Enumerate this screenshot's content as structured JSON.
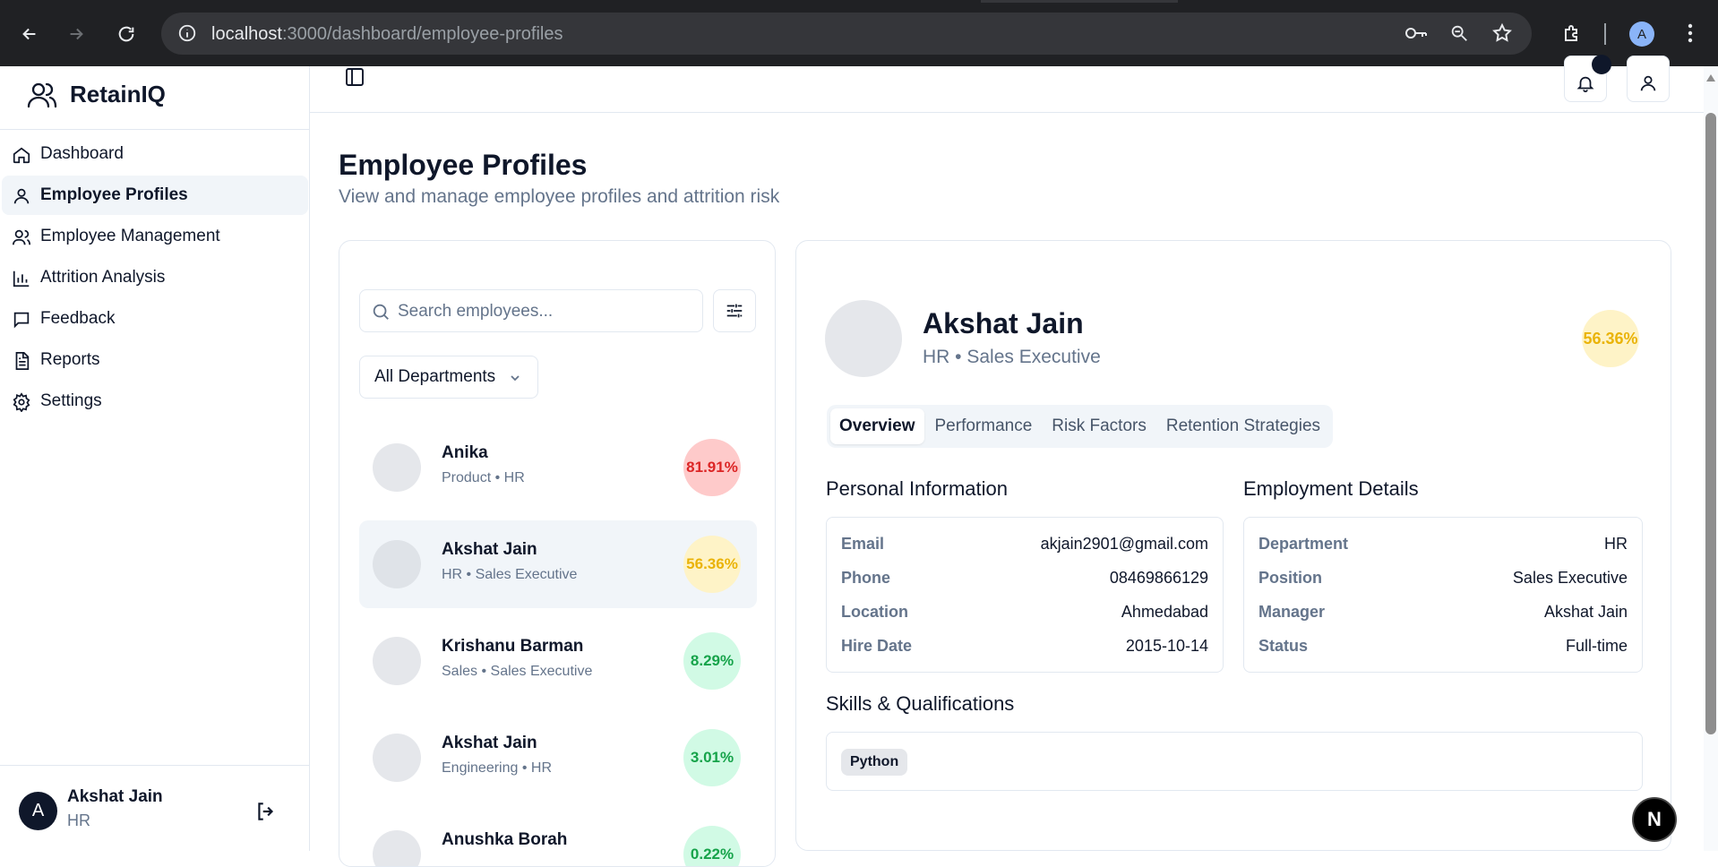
{
  "browser": {
    "url_host": "localhost",
    "url_rest": ":3000/dashboard/employee-profiles",
    "profile_initial": "A"
  },
  "sidebar": {
    "brand": "RetainIQ",
    "items": [
      {
        "label": "Dashboard",
        "icon": "home-icon"
      },
      {
        "label": "Employee Profiles",
        "icon": "user-icon"
      },
      {
        "label": "Employee Management",
        "icon": "users-icon"
      },
      {
        "label": "Attrition Analysis",
        "icon": "bar-chart-icon"
      },
      {
        "label": "Feedback",
        "icon": "message-square-icon"
      },
      {
        "label": "Reports",
        "icon": "file-text-icon"
      },
      {
        "label": "Settings",
        "icon": "gear-icon"
      }
    ],
    "active_index": 1,
    "user": {
      "initial": "A",
      "name": "Akshat Jain",
      "role": "HR"
    }
  },
  "page": {
    "title": "Employee Profiles",
    "subtitle": "View and manage employee profiles and attrition risk"
  },
  "list_panel": {
    "search_placeholder": "Search employees...",
    "department_filter": "All Departments",
    "employees": [
      {
        "name": "Anika",
        "meta": "Product • HR",
        "risk": "81.91%",
        "level": "high"
      },
      {
        "name": "Akshat Jain",
        "meta": "HR • Sales Executive",
        "risk": "56.36%",
        "level": "med",
        "selected": true
      },
      {
        "name": "Krishanu Barman",
        "meta": "Sales • Sales Executive",
        "risk": "8.29%",
        "level": "low"
      },
      {
        "name": "Akshat Jain",
        "meta": "Engineering • HR",
        "risk": "3.01%",
        "level": "low"
      },
      {
        "name": "Anushka Borah",
        "meta": "",
        "risk": "0.22%",
        "level": "low"
      }
    ]
  },
  "profile": {
    "name": "Akshat Jain",
    "role": "HR • Sales Executive",
    "risk": "56.36%",
    "tabs": [
      "Overview",
      "Performance",
      "Risk Factors",
      "Retention Strategies"
    ],
    "active_tab": 0,
    "personal_title": "Personal Information",
    "personal": [
      {
        "label": "Email",
        "value": "akjain2901@gmail.com"
      },
      {
        "label": "Phone",
        "value": "08469866129"
      },
      {
        "label": "Location",
        "value": "Ahmedabad"
      },
      {
        "label": "Hire Date",
        "value": "2015-10-14"
      }
    ],
    "employment_title": "Employment Details",
    "employment": [
      {
        "label": "Department",
        "value": "HR"
      },
      {
        "label": "Position",
        "value": "Sales Executive"
      },
      {
        "label": "Manager",
        "value": "Akshat Jain"
      },
      {
        "label": "Status",
        "value": "Full-time"
      }
    ],
    "skills_title": "Skills & Qualifications",
    "skills": [
      "Python"
    ]
  },
  "dev_badge": "N",
  "colors": {
    "risk_high": "#dc2626",
    "risk_med": "#eab308",
    "risk_low": "#16a34a"
  }
}
